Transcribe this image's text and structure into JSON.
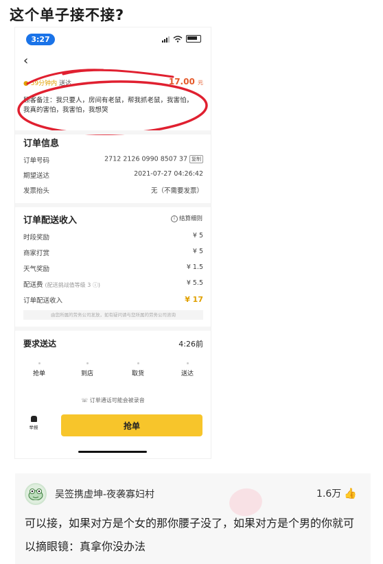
{
  "post": {
    "title": "这个单子接不接?"
  },
  "phone": {
    "status_time": "3:27",
    "back_icon": "chevron-left-icon",
    "order_header": {
      "left_text": "59分钟内",
      "left_sub": "送达",
      "price": "17.00",
      "price_unit": "元"
    },
    "remark": "顾客备注：我只要人，房间有老鼠，帮我抓老鼠，我害怕，我真的害怕，我害怕，我想哭",
    "order_info": {
      "title": "订单信息",
      "rows": [
        {
          "label": "订单号码",
          "value": "2712 2126 0990 8507 37",
          "tag": "复制"
        },
        {
          "label": "期望送达",
          "value": "2021-07-27 04:26:42"
        },
        {
          "label": "发票抬头",
          "value": "无（不需要发票）"
        }
      ]
    },
    "income": {
      "title": "订单配送收入",
      "detail_link": "结算细则",
      "rows": [
        {
          "label": "时段奖励",
          "value": "¥ 5"
        },
        {
          "label": "商家打赏",
          "value": "¥ 5"
        },
        {
          "label": "天气奖励",
          "value": "¥ 1.5"
        },
        {
          "label": "配送费",
          "hint": "(配送挑战值等级 3 ⓘ)",
          "value": "¥ 5.5"
        },
        {
          "label": "订单配送收入",
          "value": "¥ 17"
        }
      ],
      "footnote": "由您所属的劳务公司发放，如有疑问请与您所属的劳务公司咨询"
    },
    "requirement": {
      "label": "要求送达",
      "value": "4:26前"
    },
    "steps": [
      "抢单",
      "到店",
      "取货",
      "送达"
    ],
    "record_note": "订单通话可能会被录音",
    "report_label": "举报",
    "grab_button": "抢单"
  },
  "comment": {
    "username": "吴签携虚坤-夜袭寡妇村",
    "likes": "1.6万",
    "text": "可以接，如果对方是个女的那你腰子没了，如果对方是个男的你就可以摘眼镜：真拿你没办法"
  },
  "colors": {
    "accent_yellow": "#f7c52b",
    "circle_red": "#e02030",
    "price_orange": "#e55a2b"
  }
}
